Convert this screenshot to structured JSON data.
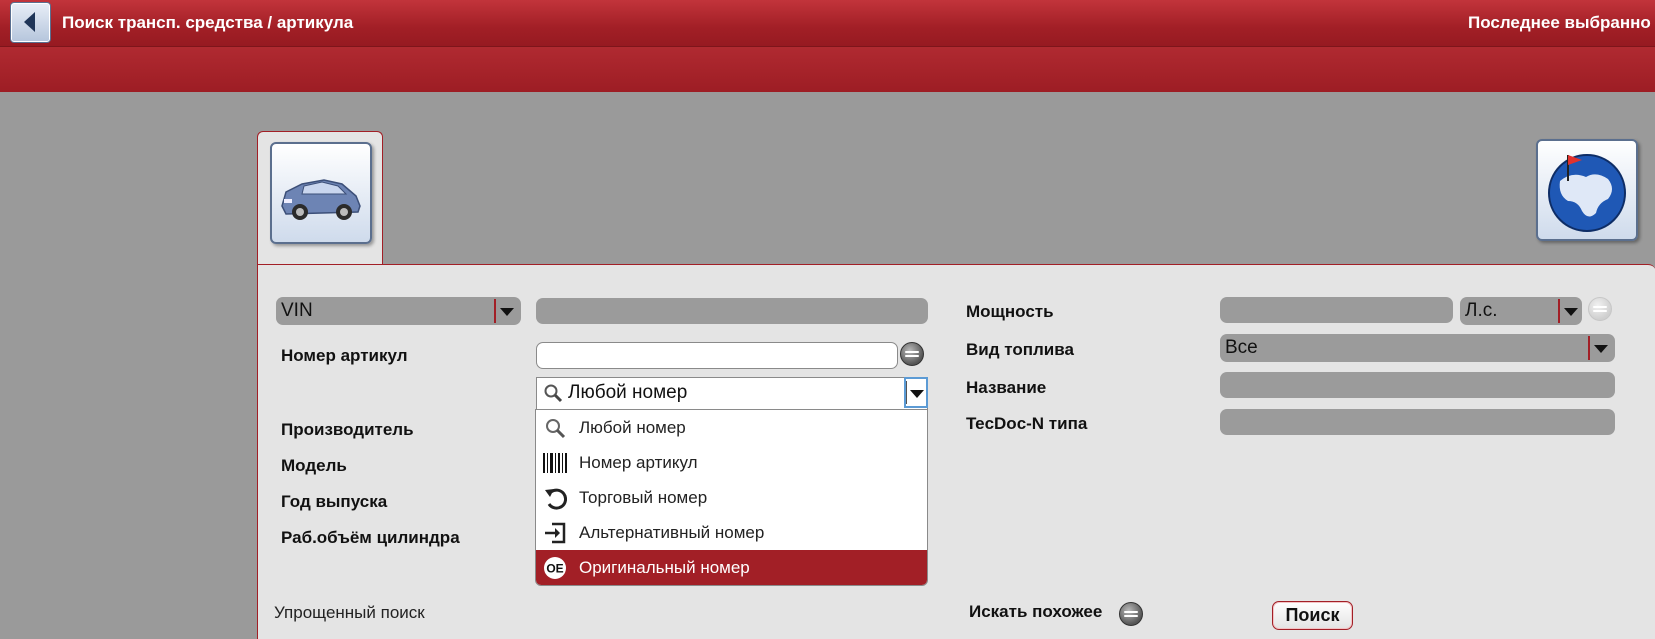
{
  "header": {
    "title": "Поиск трансп. средства / артикула",
    "recent_label": "Последнее выбранно"
  },
  "tabs": {
    "vehicle_tab_icon": "car-icon",
    "globe_icon": "globe-icon"
  },
  "form": {
    "vin_select": {
      "value": "VIN"
    },
    "article_number_label": "Номер артикул",
    "article_number_value": "",
    "number_type_select": {
      "value": "Любой номер"
    },
    "manufacturer_label": "Производитель",
    "model_label": "Модель",
    "year_label": "Год выпуска",
    "engine_label": "Раб.объём цилиндра",
    "power_label": "Мощность",
    "power_unit_select": {
      "value": "Л.с."
    },
    "fuel_label": "Вид топлива",
    "fuel_select": {
      "value": "Все"
    },
    "name_label": "Название",
    "tecdoc_label": "TecDoc-N типа",
    "simple_search_link": "Упрощенный поиск",
    "similar_label": "Искать похожее",
    "search_button": "Поиск"
  },
  "dropdown": {
    "items": [
      {
        "label": "Любой номер",
        "icon": "magnifier-icon",
        "selected": false
      },
      {
        "label": "Номер артикул",
        "icon": "barcode-icon",
        "selected": false
      },
      {
        "label": "Торговый номер",
        "icon": "undo-arrow-icon",
        "selected": false
      },
      {
        "label": "Альтернативный номер",
        "icon": "enter-box-icon",
        "selected": false
      },
      {
        "label": "Оригинальный номер",
        "icon": "oe-badge-icon",
        "selected": true
      }
    ],
    "oe_badge_text": "OE"
  },
  "colors": {
    "brand_red": "#a21f26",
    "panel_bg": "#e4e4e4",
    "page_bg": "#9a9a9a",
    "focus_blue": "#5c9bd5"
  }
}
